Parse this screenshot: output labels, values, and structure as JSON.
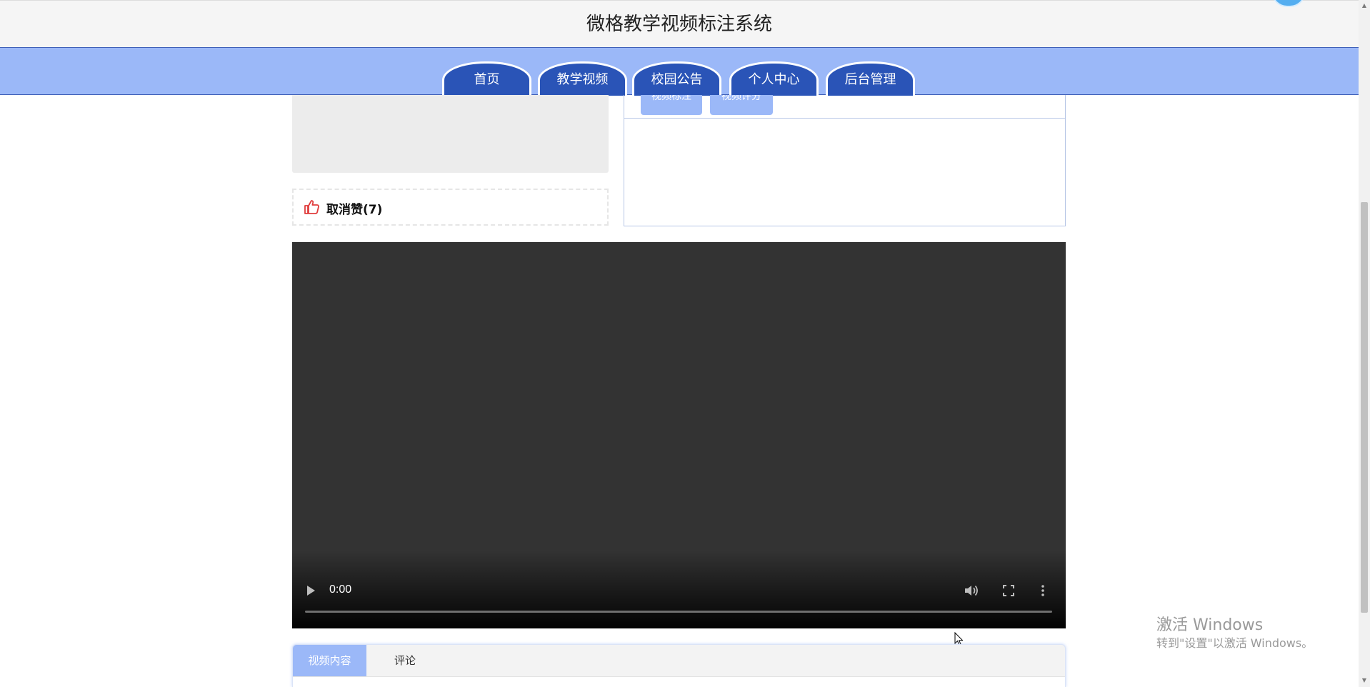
{
  "header": {
    "title": "微格教学视频标注系统"
  },
  "nav": {
    "tabs": [
      {
        "label": "首页"
      },
      {
        "label": "教学视频"
      },
      {
        "label": "校园公告"
      },
      {
        "label": "个人中心"
      },
      {
        "label": "后台管理"
      }
    ]
  },
  "like": {
    "label": "取消赞(7)",
    "icon": "thumbs-up-icon",
    "color": "#e03c3c"
  },
  "annotation_panel": {
    "buttons": [
      {
        "label": "视频标注"
      },
      {
        "label": "视频评分"
      }
    ]
  },
  "video_player": {
    "current_time": "0:00",
    "progress": 0,
    "icons": [
      "play-icon",
      "volume-icon",
      "fullscreen-icon",
      "more-options-icon"
    ]
  },
  "bottom_tabs": {
    "tabs": [
      {
        "label": "视频内容",
        "active": true
      },
      {
        "label": "评论",
        "active": false
      }
    ]
  },
  "os_watermark": {
    "title": "激活 Windows",
    "subtitle": "转到\"设置\"以激活 Windows。"
  },
  "colors": {
    "accent": "#9bb8f8",
    "nav_tab": "#2a54b7",
    "video_bg": "#333333"
  }
}
